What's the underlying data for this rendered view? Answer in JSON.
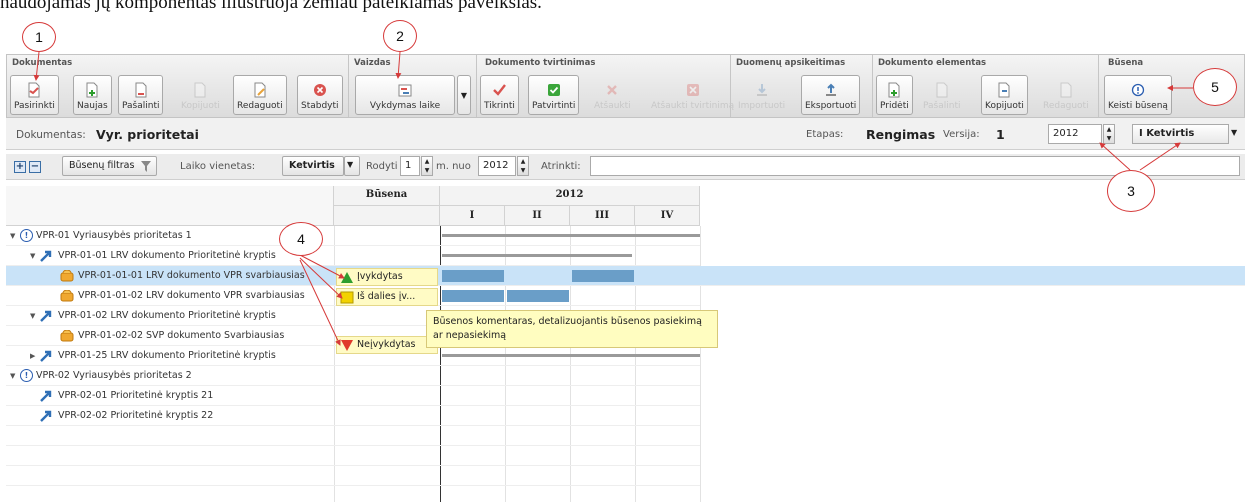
{
  "caption": "naudojamas jų komponentas iliustruoja žemiau pateikiamas paveikslas.",
  "ribbon": {
    "groups": [
      {
        "title": "Dokumentas",
        "buttons": [
          {
            "label": "Pasirinkti",
            "enabled": true
          },
          {
            "label": "Naujas",
            "enabled": true
          },
          {
            "label": "Pašalinti",
            "enabled": true
          },
          {
            "label": "Kopijuoti",
            "enabled": false
          },
          {
            "label": "Redaguoti",
            "enabled": true
          },
          {
            "label": "Stabdyti",
            "enabled": true
          }
        ]
      },
      {
        "title": "Vaizdas",
        "buttons": [
          {
            "label": "Vykdymas laike",
            "enabled": true
          }
        ]
      },
      {
        "title": "Dokumento tvirtinimas",
        "buttons": [
          {
            "label": "Tikrinti",
            "enabled": true
          },
          {
            "label": "Patvirtinti",
            "enabled": true
          },
          {
            "label": "Atšaukti",
            "enabled": false
          },
          {
            "label": "Atšaukti tvirtinimą",
            "enabled": false
          }
        ]
      },
      {
        "title": "Duomenų apsikeitimas",
        "buttons": [
          {
            "label": "Importuoti",
            "enabled": false
          },
          {
            "label": "Eksportuoti",
            "enabled": true
          }
        ]
      },
      {
        "title": "Dokumento elementas",
        "buttons": [
          {
            "label": "Pridėti",
            "enabled": true
          },
          {
            "label": "Pašalinti",
            "enabled": false
          },
          {
            "label": "Kopijuoti",
            "enabled": true
          },
          {
            "label": "Redaguoti",
            "enabled": false
          }
        ]
      },
      {
        "title": "Būsena",
        "buttons": [
          {
            "label": "Keisti būseną",
            "enabled": true
          }
        ]
      }
    ]
  },
  "docbar": {
    "doc_label": "Dokumentas:",
    "doc_value": "Vyr. prioritetai",
    "stage_label": "Etapas:",
    "stage_value": "Rengimas",
    "version_label": "Versija:",
    "version_value": "1",
    "year_value": "2012",
    "period_value": "I Ketvirtis"
  },
  "filterbar": {
    "expand_symbol": "+",
    "collapse_symbol": "−",
    "status_filter_label": "Būsenų filtras",
    "time_unit_label": "Laiko vienetas:",
    "time_unit_value": "Ketvirtis",
    "show_label": "Rodyti",
    "show_value": "1",
    "from_label": "m. nuo",
    "from_value": "2012",
    "select_label": "Atrinkti:",
    "select_value": ""
  },
  "grid": {
    "status_header": "Būsena",
    "year_header": "2012",
    "quarters": [
      "I",
      "II",
      "III",
      "IV"
    ],
    "rows": [
      {
        "text": "VPR-01 Vyriausybės prioritetas 1",
        "icon": "exclamation-circle-icon"
      },
      {
        "text": "VPR-01-01 LRV dokumento Prioritetinė kryptis",
        "icon": "direction-arrow-icon"
      },
      {
        "text": "VPR-01-01-01 LRV dokumento VPR svarbiausias",
        "icon": "task-icon",
        "status": "Įvykdytas",
        "status_icon": "green-triangle-up-icon"
      },
      {
        "text": "VPR-01-01-02 LRV dokumento VPR svarbiausias",
        "icon": "task-icon",
        "status": "Iš dalies įv...",
        "status_icon": "yellow-square-icon"
      },
      {
        "text": "VPR-01-02 LRV dokumento Prioritetinė kryptis",
        "icon": "direction-arrow-icon"
      },
      {
        "text": "VPR-01-02-02 SVP dokumento Svarbiausias",
        "icon": "task-icon",
        "status": "Neįvykdytas",
        "status_icon": "red-triangle-down-icon"
      },
      {
        "text": "VPR-01-25 LRV dokumento Prioritetinė kryptis",
        "icon": "direction-arrow-icon"
      },
      {
        "text": "VPR-02 Vyriausybės prioritetas 2",
        "icon": "exclamation-circle-icon"
      },
      {
        "text": "VPR-02-01 Prioritetinė kryptis 21",
        "icon": "direction-arrow-icon"
      },
      {
        "text": "VPR-02-02 Prioritetinė kryptis 22",
        "icon": "direction-arrow-icon"
      }
    ],
    "tooltip": "Būsenos komentaras, detalizuojantis būsenos pasiekimą ar nepasiekimą"
  },
  "callouts": [
    "1",
    "2",
    "3",
    "4",
    "5"
  ],
  "colors": {
    "callout_border": "#d63a3a",
    "bar_blue": "#6a9ec8",
    "selected_row": "#c9e3f8",
    "status_bg": "#fffbc5",
    "status_done": "#2e9e2e",
    "status_partial": "#f2d200",
    "status_not_done": "#e03b2b"
  }
}
